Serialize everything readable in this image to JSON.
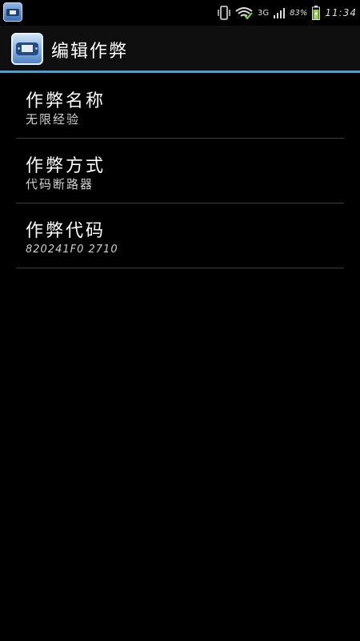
{
  "status_bar": {
    "app_icon": "emulator-app-icon",
    "vibrate_icon": "vibrate-icon",
    "wifi_icon": "wifi-icon",
    "network_type": "3G",
    "signal_icon": "signal-icon",
    "battery_percent": "83%",
    "battery_icon": "battery-charging-icon",
    "time": "11:34"
  },
  "action_bar": {
    "logo_icon": "gba-emulator-logo-icon",
    "title": "编辑作弊"
  },
  "preferences": [
    {
      "title": "作弊名称",
      "summary": "无限经验"
    },
    {
      "title": "作弊方式",
      "summary": "代码断路器"
    },
    {
      "title": "作弊代码",
      "summary": "820241F0 2710"
    }
  ],
  "colors": {
    "accent": "#4c9fd0",
    "background": "#000000",
    "divider": "#3a3a3a"
  }
}
